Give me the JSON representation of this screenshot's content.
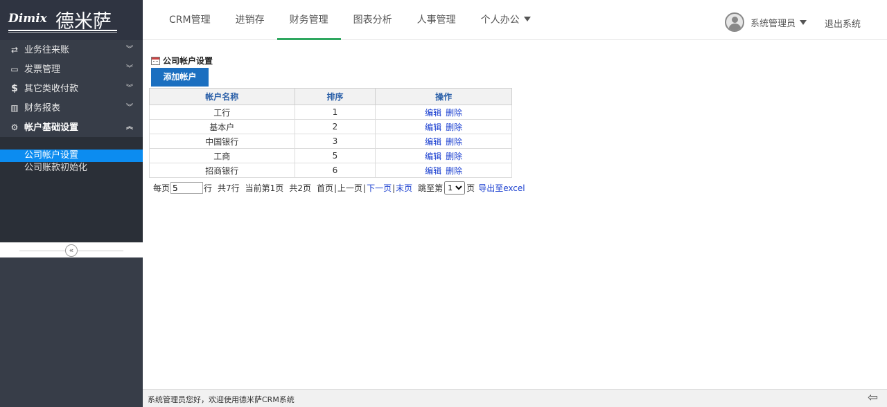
{
  "logo": {
    "latin": "Dimix",
    "cn": "德米萨"
  },
  "nav": {
    "items": [
      {
        "label": "CRM管理"
      },
      {
        "label": "进销存"
      },
      {
        "label": "财务管理"
      },
      {
        "label": "图表分析"
      },
      {
        "label": "人事管理"
      },
      {
        "label": "个人办公"
      }
    ],
    "active_index": 2
  },
  "user": {
    "name": "系统管理员",
    "logout": "退出系统"
  },
  "sidebar": {
    "items": [
      {
        "label": "业务往来账",
        "icon": "exchange-icon"
      },
      {
        "label": "发票管理",
        "icon": "credit-card-icon"
      },
      {
        "label": "其它类收付款",
        "icon": "dollar-icon"
      },
      {
        "label": "财务报表",
        "icon": "bar-chart-icon"
      },
      {
        "label": "帐户基础设置",
        "icon": "gear-icon"
      }
    ],
    "subitems": [
      {
        "label": "公司帐户设置"
      },
      {
        "label": "公司账款初始化"
      }
    ]
  },
  "main": {
    "title": "公司帐户设置",
    "add_button": "添加帐户",
    "table": {
      "headers": [
        "帐户名称",
        "排序",
        "操作"
      ],
      "rows": [
        {
          "name": "工行",
          "order": "1"
        },
        {
          "name": "基本户",
          "order": "2"
        },
        {
          "name": "中国银行",
          "order": "3"
        },
        {
          "name": "工商",
          "order": "5"
        },
        {
          "name": "招商银行",
          "order": "6"
        }
      ],
      "edit_label": "编辑",
      "delete_label": "删除"
    },
    "pager": {
      "per_page_label": "每页",
      "per_page_value": "5",
      "rows_label": "行",
      "total_rows": "共7行",
      "current_page": "当前第1页",
      "total_pages": "共2页",
      "first": "首页",
      "prev": "上一页",
      "next": "下一页",
      "last": "末页",
      "jump_label": "跳至第",
      "jump_value": "1",
      "page_label": "页",
      "export": "导出至excel"
    }
  },
  "footer": {
    "message": "系统管理员您好，欢迎使用德米萨CRM系统"
  },
  "colors": {
    "sidebar": "#373d48",
    "active_tab": "#2ea75f",
    "button": "#1b6fc0",
    "active_sub": "#0c8cf0"
  }
}
